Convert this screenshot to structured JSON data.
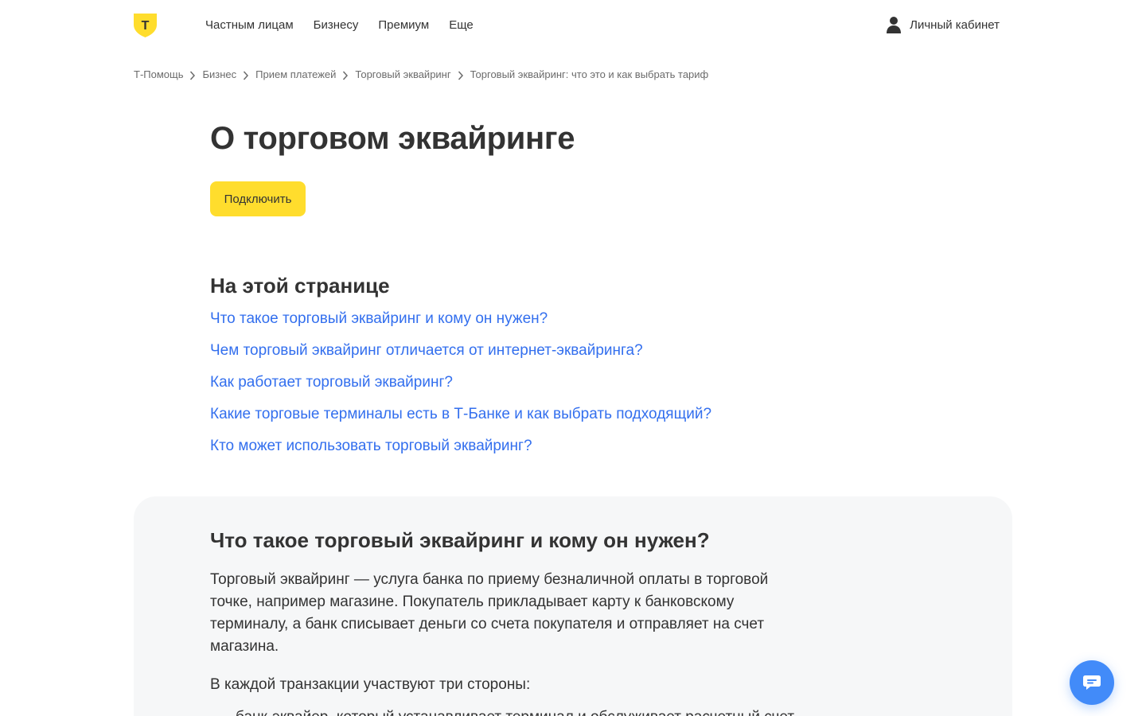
{
  "header": {
    "logo_letter": "Т",
    "nav": [
      "Частным лицам",
      "Бизнесу",
      "Премиум",
      "Еще"
    ],
    "account_label": "Личный кабинет"
  },
  "breadcrumb": [
    "Т-Помощь",
    "Бизнес",
    "Прием платежей",
    "Торговый эквайринг",
    "Торговый эквайринг: что это и как выбрать тариф"
  ],
  "page": {
    "title": "О торговом эквайринге",
    "connect_button": "Подключить"
  },
  "toc": {
    "title": "На этой странице",
    "items": [
      "Что такое торговый эквайринг и кому он нужен?",
      "Чем торговый эквайринг отличается от интернет-эквайринга?",
      "Как работает торговый эквайринг?",
      "Какие торговые терминалы есть в Т-Банке и как выбрать подходящий?",
      "Кто может использовать торговый эквайринг?"
    ]
  },
  "section": {
    "title": "Что такое торговый эквайринг и кому он нужен?",
    "paragraph1": "Торговый эквайринг — услуга банка по приему безналичной оплаты в торговой точке, например магазине. Покупатель прикладывает карту к банковскому терминалу, а банк списывает деньги со счета покупателя и отправляет на счет магазина.",
    "paragraph2": "В каждой транзакции участвуют три стороны:",
    "list_item1": "банк-эквайер, который устанавливает терминал и обслуживает расчетный счет"
  },
  "colors": {
    "brand_yellow": "#ffdd2d",
    "link_blue": "#336fee",
    "chat_blue": "#428bf9",
    "section_bg": "#f6f7f8"
  },
  "icons": {
    "logo": "tbank-shield-logo",
    "account": "user-icon",
    "breadcrumb_separator": "chevron-right-icon",
    "chat": "chat-bubble-icon"
  }
}
